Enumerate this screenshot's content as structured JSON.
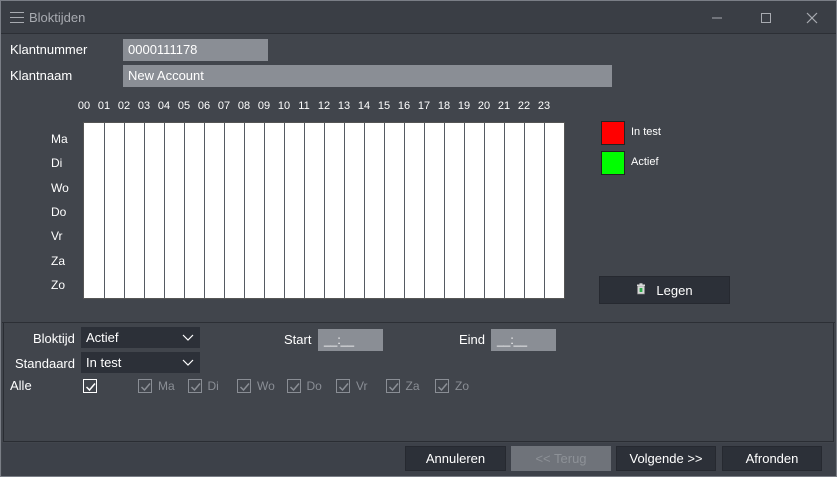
{
  "window": {
    "title": "Bloktijden"
  },
  "form": {
    "klantnummer_label": "Klantnummer",
    "klantnummer_value": "0000111178",
    "klantnaam_label": "Klantnaam",
    "klantnaam_value": "New Account"
  },
  "schedule": {
    "hours": [
      "00",
      "01",
      "02",
      "03",
      "04",
      "05",
      "06",
      "07",
      "08",
      "09",
      "10",
      "11",
      "12",
      "13",
      "14",
      "15",
      "16",
      "17",
      "18",
      "19",
      "20",
      "21",
      "22",
      "23"
    ],
    "days": [
      "Ma",
      "Di",
      "Wo",
      "Do",
      "Vr",
      "Za",
      "Zo"
    ]
  },
  "legend": {
    "items": [
      {
        "label": "In test",
        "color": "#ff0000"
      },
      {
        "label": "Actief",
        "color": "#00ff00"
      }
    ],
    "clear_label": "Legen"
  },
  "controls": {
    "bloktijd_label": "Bloktijd",
    "bloktijd_value": "Actief",
    "standaard_label": "Standaard",
    "standaard_value": "In test",
    "start_label": "Start",
    "start_value": "__:__",
    "eind_label": "Eind",
    "eind_value": "__:__",
    "alle_label": "Alle",
    "day_checks": [
      "Ma",
      "Di",
      "Wo",
      "Do",
      "Vr",
      "Za",
      "Zo"
    ]
  },
  "footer": {
    "cancel": "Annuleren",
    "back": "<< Terug",
    "next": "Volgende >>",
    "finish": "Afronden"
  }
}
